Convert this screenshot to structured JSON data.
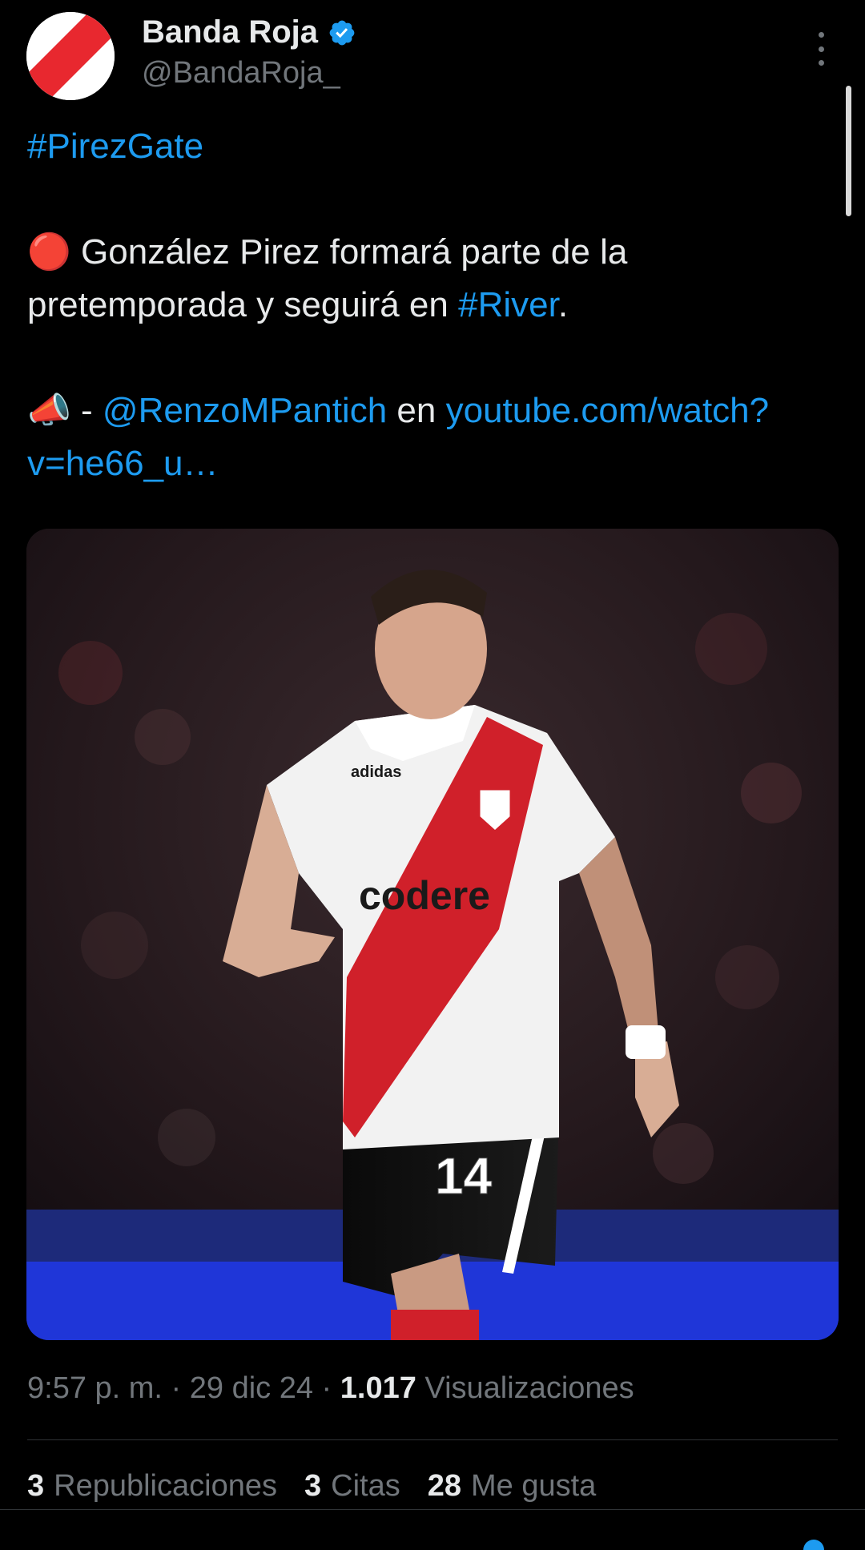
{
  "author": {
    "display_name": "Banda Roja",
    "handle": "@BandaRoja_",
    "verified": true
  },
  "tweet": {
    "hashtag_line": "#PirezGate",
    "line2_emoji": "🔴",
    "line2_text": " González Pirez formará parte de la pretemporada y seguirá en ",
    "line2_link": "#River",
    "line2_end": ".",
    "line3_emoji": "📣",
    "line3_dash": " - ",
    "line3_mention": "@RenzoMPantich",
    "line3_en": " en ",
    "line3_url": "youtube.com/watch?v=he66_u…"
  },
  "media": {
    "jersey_sponsor": "codere",
    "jersey_number": "14",
    "brand": "adidas"
  },
  "meta": {
    "time": "9:57 p. m.",
    "sep1": " · ",
    "date": "29 dic 24",
    "sep2": " · ",
    "views_count": "1.017",
    "views_label": " Visualizaciones"
  },
  "stats": {
    "reposts_count": "3",
    "reposts_label": "Republicaciones",
    "quotes_count": "3",
    "quotes_label": "Citas",
    "likes_count": "28",
    "likes_label": "Me gusta"
  },
  "colors": {
    "accent": "#1d9bf0",
    "background": "#000000",
    "text": "#e7e9ea",
    "secondary": "#71767b",
    "river_red": "#d0202a"
  },
  "icons": {
    "verified": "verified-badge-icon",
    "more": "more-vertical-icon"
  }
}
